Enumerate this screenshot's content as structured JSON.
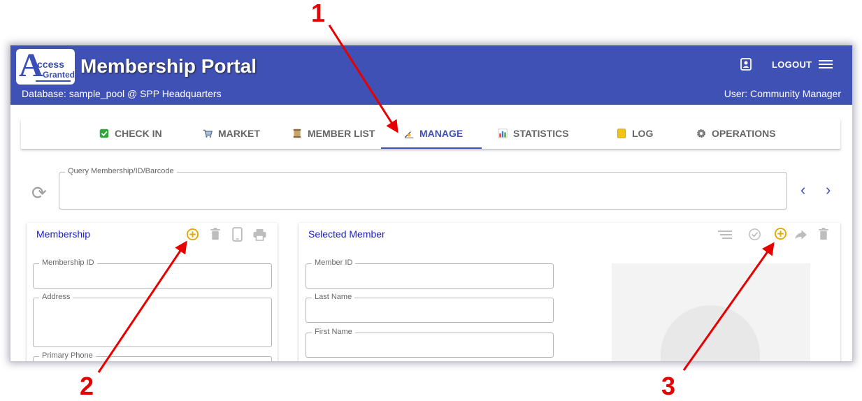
{
  "header": {
    "logo_line1": "ccess",
    "logo_line2": "Granted",
    "title": "Membership Portal",
    "database": "Database: sample_pool @ SPP Headquarters",
    "user": "User: Community Manager",
    "logout_label": "LOGOUT"
  },
  "tabs": [
    {
      "label": "CHECK IN",
      "icon": "check-box-icon",
      "active": false
    },
    {
      "label": "MARKET",
      "icon": "cart-icon",
      "active": false
    },
    {
      "label": "MEMBER LIST",
      "icon": "scroll-icon",
      "active": false
    },
    {
      "label": "MANAGE",
      "icon": "writing-hand-icon",
      "active": true
    },
    {
      "label": "STATISTICS",
      "icon": "bar-chart-icon",
      "active": false
    },
    {
      "label": "LOG",
      "icon": "notebook-icon",
      "active": false
    },
    {
      "label": "OPERATIONS",
      "icon": "gear-icon",
      "active": false
    }
  ],
  "query": {
    "label": "Query Membership/ID/Barcode",
    "value": ""
  },
  "membership": {
    "title": "Membership",
    "fields": {
      "membership_id": "Membership ID",
      "address": "Address",
      "primary_phone": "Primary Phone"
    }
  },
  "member": {
    "title": "Selected Member",
    "fields": {
      "member_id": "Member ID",
      "last_name": "Last Name",
      "first_name": "First Name"
    }
  },
  "annotations": [
    "1",
    "2",
    "3"
  ],
  "colors": {
    "header": "#3f51b5",
    "accent": "#e6a800",
    "annotation": "#e60000",
    "link": "#1a1ad6"
  }
}
